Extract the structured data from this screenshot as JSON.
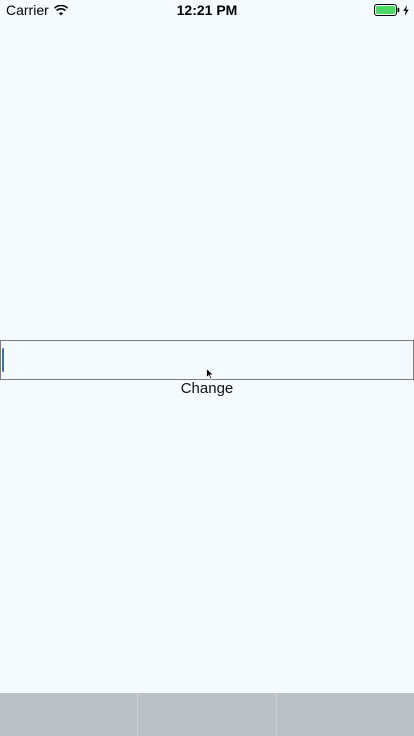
{
  "status_bar": {
    "carrier": "Carrier",
    "time": "12:21 PM",
    "battery_color": "#4CD964"
  },
  "form": {
    "text_field_value": "",
    "button_label": "Change"
  },
  "colors": {
    "background": "#F4FAFE",
    "keyboard_bar": "#BCC1C8"
  },
  "keyboard": {
    "key_count": 3
  }
}
